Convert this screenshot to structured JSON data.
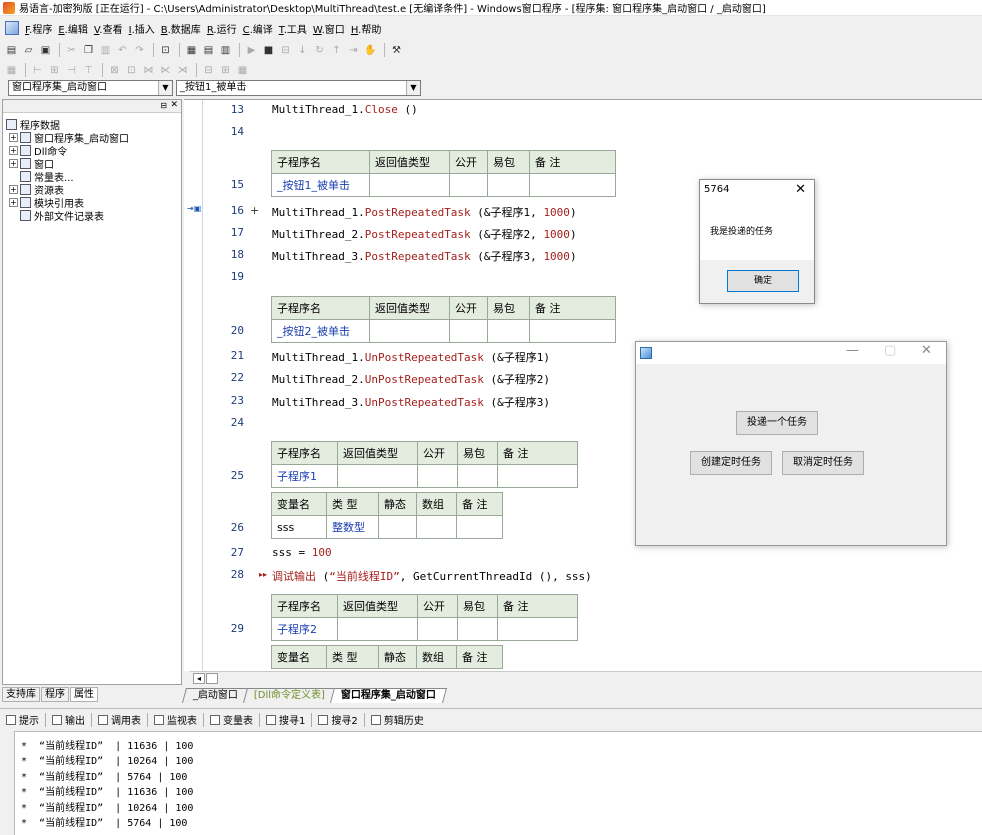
{
  "window": {
    "title": "易语言-加密狗版 [正在运行] - C:\\Users\\Administrator\\Desktop\\MultiThread\\test.e [无编译条件] - Windows窗口程序 - [程序集: 窗口程序集_启动窗口 / _启动窗口]"
  },
  "menu": [
    {
      "key": "F",
      "label": ".程序"
    },
    {
      "key": "E",
      "label": ".编辑"
    },
    {
      "key": "V",
      "label": ".查看"
    },
    {
      "key": "I",
      "label": ".插入"
    },
    {
      "key": "B",
      "label": ".数据库"
    },
    {
      "key": "R",
      "label": ".运行"
    },
    {
      "key": "C",
      "label": ".编译"
    },
    {
      "key": "T",
      "label": ".工具"
    },
    {
      "key": "W",
      "label": ".窗口"
    },
    {
      "key": "H",
      "label": ".帮助"
    }
  ],
  "combos": {
    "left": "窗口程序集_启动窗口",
    "right": "_按钮1_被单击"
  },
  "tree": {
    "root": "程序数据",
    "items": [
      {
        "label": "窗口程序集_启动窗口",
        "expand": "+"
      },
      {
        "label": "Dll命令",
        "expand": "+"
      },
      {
        "label": "窗口",
        "expand": "+"
      },
      {
        "label": "常量表...",
        "expand": ""
      },
      {
        "label": "资源表",
        "expand": "+"
      },
      {
        "label": "模块引用表",
        "expand": "+"
      },
      {
        "label": "外部文件记录表",
        "expand": ""
      }
    ],
    "tabs": [
      "支持库",
      "程序",
      "属性"
    ]
  },
  "code": {
    "line_numbers": [
      "13",
      "14",
      "15",
      "16",
      "17",
      "18",
      "19",
      "20",
      "21",
      "22",
      "23",
      "24",
      "25",
      "26",
      "27",
      "28",
      "29"
    ],
    "line13": {
      "obj": "MultiThread_1.",
      "method": "Close",
      "args": " ()"
    },
    "line16": {
      "obj": "MultiThread_1.",
      "method": "PostRepeatedTask",
      "args": " (&子程序1, ",
      "num": "1000",
      "end": ")"
    },
    "line17": {
      "obj": "MultiThread_2.",
      "method": "PostRepeatedTask",
      "args": " (&子程序2, ",
      "num": "1000",
      "end": ")"
    },
    "line18": {
      "obj": "MultiThread_3.",
      "method": "PostRepeatedTask",
      "args": " (&子程序3, ",
      "num": "1000",
      "end": ")"
    },
    "line21": {
      "obj": "MultiThread_1.",
      "method": "UnPostRepeatedTask",
      "args": " (&子程序1)"
    },
    "line22": {
      "obj": "MultiThread_2.",
      "method": "UnPostRepeatedTask",
      "args": " (&子程序2)"
    },
    "line23": {
      "obj": "MultiThread_3.",
      "method": "UnPostRepeatedTask",
      "args": " (&子程序3)"
    },
    "line27": {
      "lhs": "sss = ",
      "num": "100"
    },
    "line28": {
      "fn": "调试输出",
      "open": " (",
      "str": "“当前线程ID”",
      "mid": ", GetCurrentThreadId (), sss)"
    },
    "plus_mark": "+",
    "sub_headers": {
      "name": "子程序名",
      "ret": "返回值类型",
      "public": "公开",
      "easy": "易包",
      "note": "备 注"
    },
    "var_headers": {
      "name": "变量名",
      "type": "类 型",
      "static": "静态",
      "array": "数组",
      "note": "备 注"
    },
    "subs": [
      "_按钮1_被单击",
      "_按钮2_被单击",
      "子程序1",
      "子程序2"
    ],
    "var1": {
      "name": "sss",
      "type": "整数型"
    },
    "tabs": [
      "_启动窗口",
      "[Dll命令定义表]",
      "窗口程序集_启动窗口"
    ]
  },
  "output_tabs": [
    "提示",
    "输出",
    "调用表",
    "监视表",
    "变量表",
    "搜寻1",
    "搜寻2",
    "剪辑历史"
  ],
  "output_lines": [
    "*  “当前线程ID”  | 11636 | 100",
    "*  “当前线程ID”  | 10264 | 100",
    "*  “当前线程ID”  | 5764 | 100",
    "*  “当前线程ID”  | 11636 | 100",
    "*  “当前线程ID”  | 10264 | 100",
    "*  “当前线程ID”  | 5764 | 100"
  ],
  "msgbox": {
    "title": "5764",
    "text": "我是投递的任务",
    "ok": "确定"
  },
  "appwin": {
    "btn_post": "投递一个任务",
    "btn_create": "创建定时任务",
    "btn_cancel": "取消定时任务"
  }
}
